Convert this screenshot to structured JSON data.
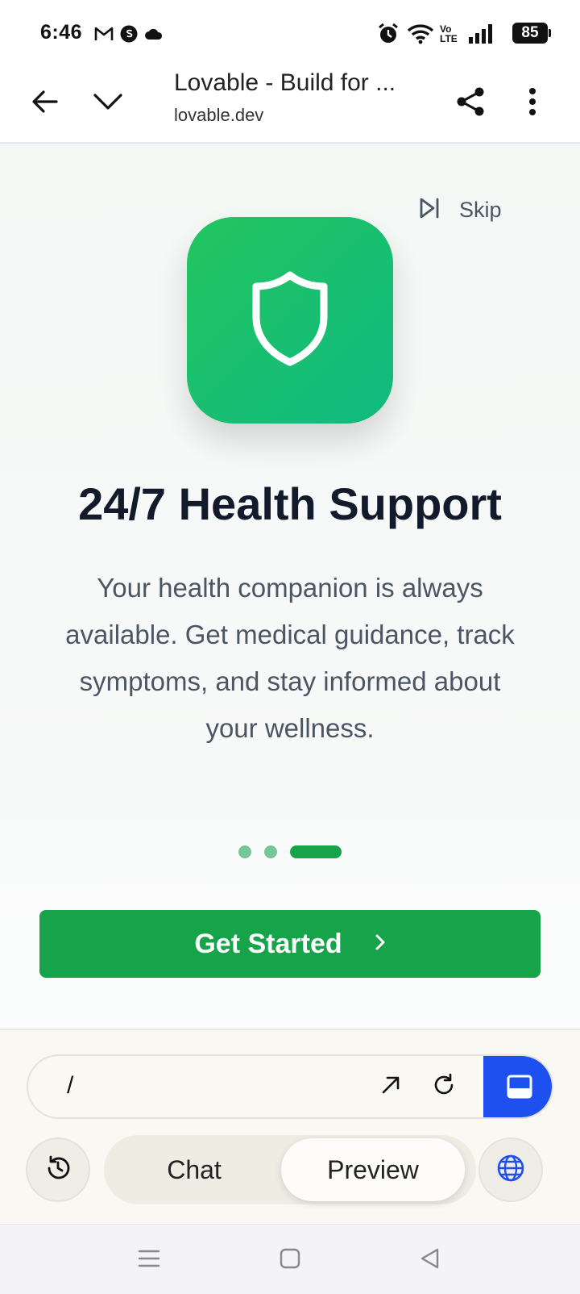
{
  "status_bar": {
    "time": "6:46",
    "battery": "85",
    "network_label": "Vo LTE"
  },
  "browser": {
    "page_title": "Lovable - Build for ...",
    "url": "lovable.dev"
  },
  "onboarding": {
    "skip_label": "Skip",
    "heading": "24/7 Health Support",
    "description": "Your health companion is always available. Get medical guidance, track symptoms, and stay informed about your wellness.",
    "cta_label": "Get Started",
    "slide_count": 3,
    "active_slide": 3,
    "accent_color": "#16a34a",
    "icon": "shield-icon"
  },
  "preview_controls": {
    "path": "/",
    "tabs": [
      "Chat",
      "Preview"
    ],
    "active_tab": "Preview",
    "accent_color": "#1e50f0"
  }
}
